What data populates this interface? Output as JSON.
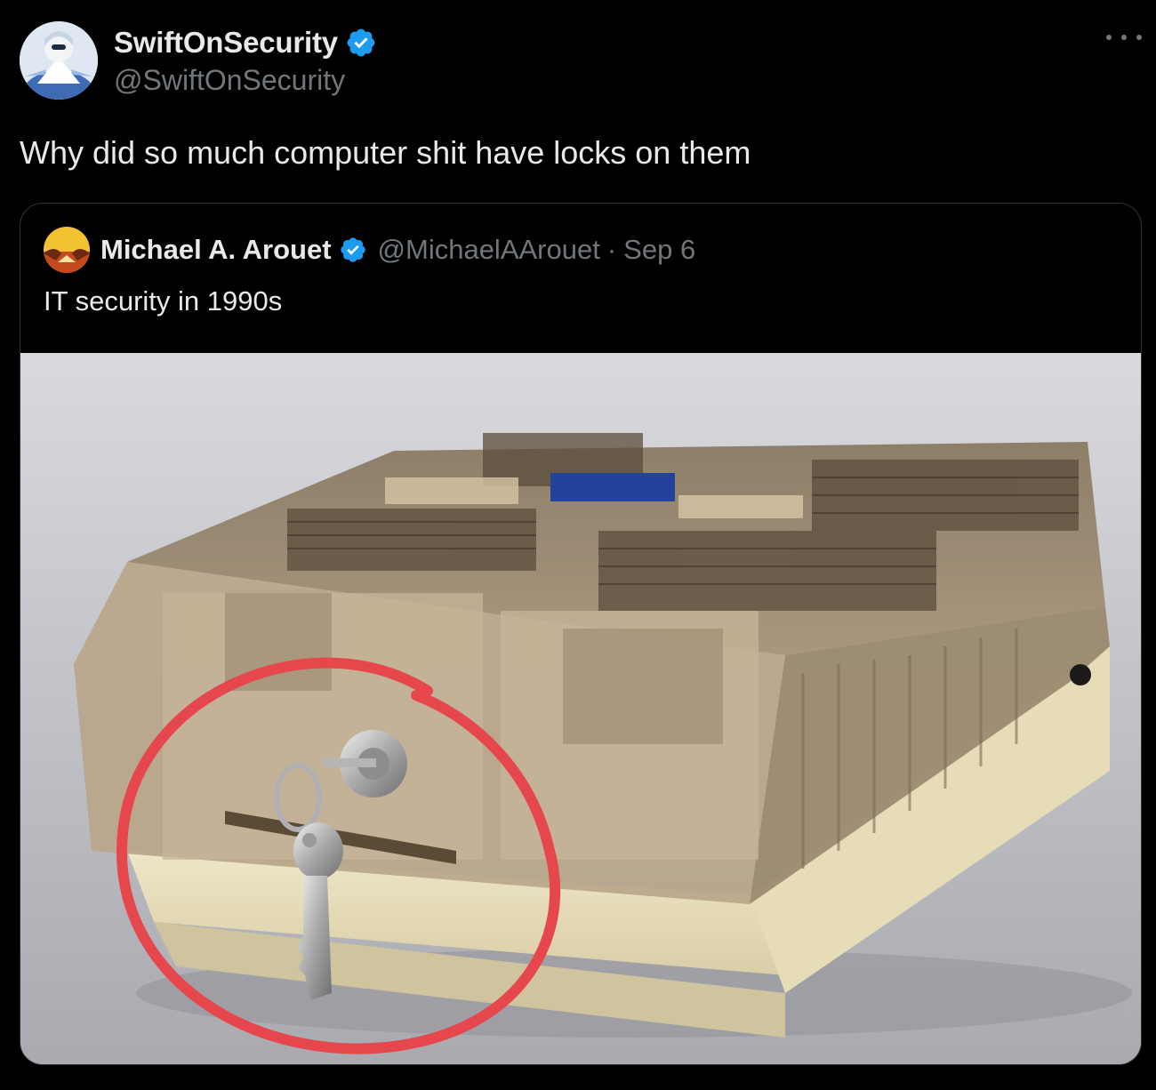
{
  "tweet": {
    "author": {
      "display_name": "SwiftOnSecurity",
      "handle": "@SwiftOnSecurity",
      "verified": true,
      "avatar_icon": "anime-avatar-icon"
    },
    "more_icon": "more-horizontal-icon",
    "text": "Why did so much computer shit have locks on them",
    "quoted_tweet": {
      "author": {
        "display_name": "Michael A. Arouet",
        "handle": "@MichaelAArouet",
        "verified": true,
        "avatar_icon": "sunset-avatar-icon"
      },
      "separator": "·",
      "date": "Sep 6",
      "text": "IT security in 1990s",
      "media": {
        "kind": "photo",
        "image_icon": "floppy-disk-storage-box-with-lock-image"
      }
    }
  },
  "colors": {
    "background": "#000000",
    "primary_text": "#e7e9ea",
    "secondary_text": "#71767b",
    "border": "#2f3336",
    "verified_blue": "#1d9bf0",
    "circle_annotation": "#e5474d"
  }
}
